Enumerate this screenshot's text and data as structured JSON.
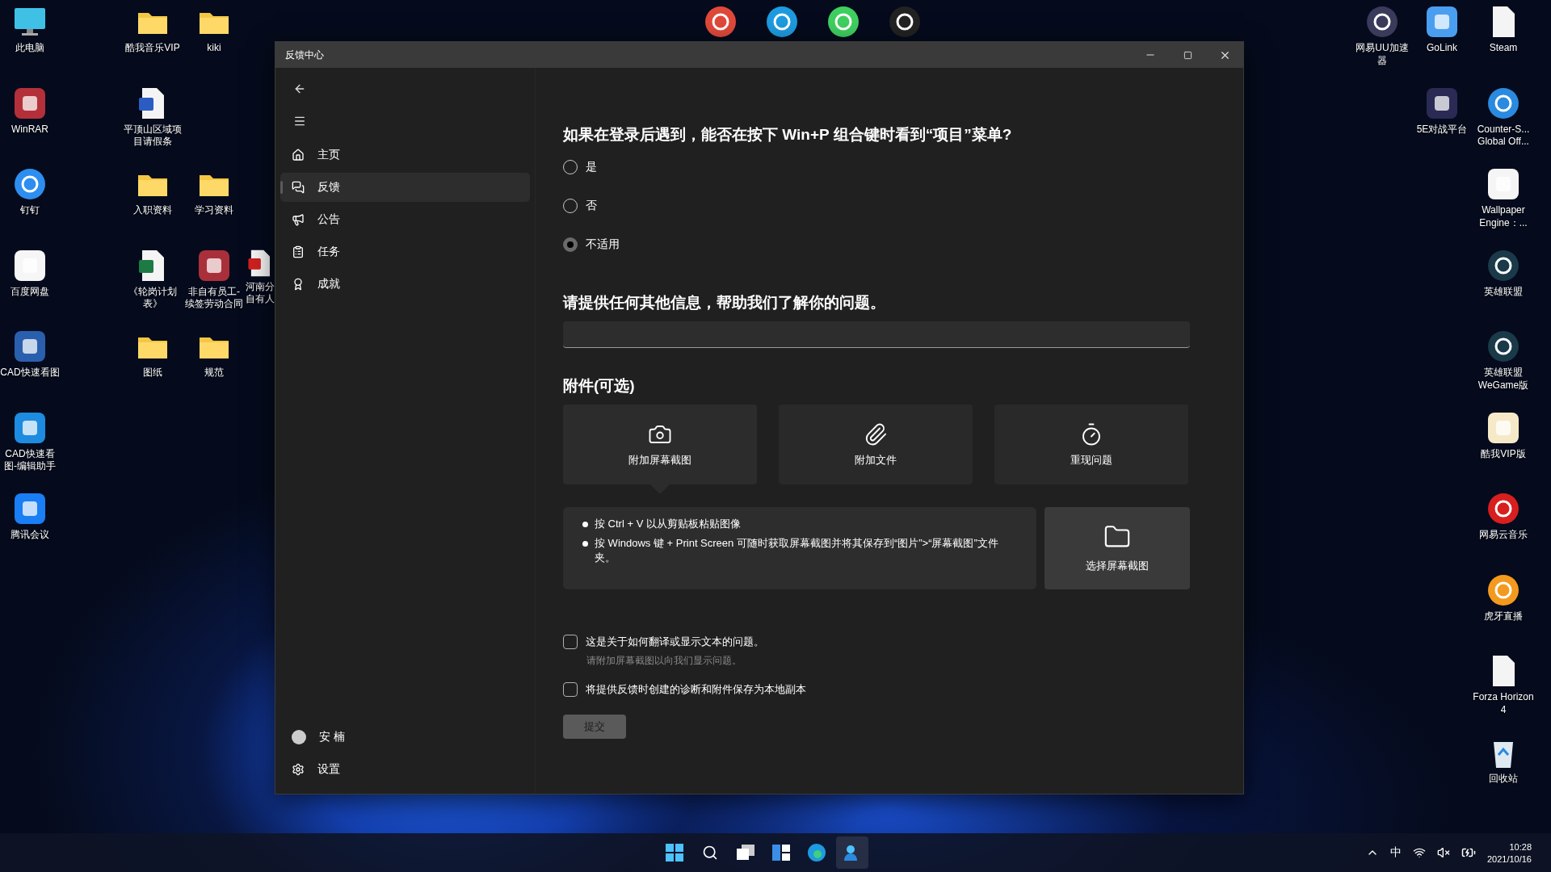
{
  "desktop": {
    "left_icons": [
      {
        "label": "此电脑"
      },
      {
        "label": "酷我音乐VIP"
      },
      {
        "label": "kiki"
      },
      {
        "label": "WinRAR"
      },
      {
        "label": "平顶山区域项目请假条"
      },
      {
        "label": "钉钉"
      },
      {
        "label": "入职资料"
      },
      {
        "label": "学习资料"
      },
      {
        "label": "百度网盘"
      },
      {
        "label": "《轮岗计划表》"
      },
      {
        "label": "非自有员工-续签劳动合同"
      },
      {
        "label": "河南分自有人"
      },
      {
        "label": "CAD快速看图"
      },
      {
        "label": "图纸"
      },
      {
        "label": "规范"
      },
      {
        "label": "CAD快速看图-编辑助手"
      },
      {
        "label": "腾讯会议"
      }
    ],
    "right_icons": [
      {
        "label": "网易UU加速器"
      },
      {
        "label": "GoLink"
      },
      {
        "label": "Steam"
      },
      {
        "label": "5E对战平台"
      },
      {
        "label": "Counter-S... Global Off..."
      },
      {
        "label": "Wallpaper Engine：..."
      },
      {
        "label": "英雄联盟"
      },
      {
        "label": "英雄联盟WeGame版"
      },
      {
        "label": "酷我VIP版"
      },
      {
        "label": "网易云音乐"
      },
      {
        "label": "虎牙直播"
      },
      {
        "label": "Forza Horizon 4"
      },
      {
        "label": "回收站"
      }
    ]
  },
  "window": {
    "title": "反馈中心",
    "sidebar": {
      "items": [
        {
          "label": "主页",
          "selected": false
        },
        {
          "label": "反馈",
          "selected": true
        },
        {
          "label": "公告",
          "selected": false
        },
        {
          "label": "任务",
          "selected": false
        },
        {
          "label": "成就",
          "selected": false
        }
      ],
      "user": "安 楠",
      "settings": "设置"
    },
    "question": {
      "title": "如果在登录后遇到，能否在按下 Win+P 组合键时看到“项目”菜单?",
      "options": [
        {
          "label": "是",
          "selected": false
        },
        {
          "label": "否",
          "selected": false
        },
        {
          "label": "不适用",
          "selected": true
        }
      ]
    },
    "details": {
      "title": "请提供任何其他信息，帮助我们了解你的问题。"
    },
    "attachments": {
      "title": "附件(可选)",
      "tiles": [
        {
          "label": "附加屏幕截图",
          "selected": true
        },
        {
          "label": "附加文件",
          "selected": false
        },
        {
          "label": "重现问题",
          "selected": false
        }
      ],
      "tips": [
        "按 Ctrl + V 以从剪贴板粘贴图像",
        "按 Windows 键 + Print Screen 可随时获取屏幕截图并将其保存到“图片”>“屏幕截图”文件夹。"
      ],
      "choose": "选择屏幕截图"
    },
    "checkboxes": [
      {
        "label": "这是关于如何翻译或显示文本的问题。",
        "hint": "请附加屏幕截图以向我们显示问题。",
        "checked": false
      },
      {
        "label": "将提供反馈时创建的诊断和附件保存为本地副本",
        "checked": false
      }
    ],
    "submit": {
      "label": "提交",
      "disabled": true
    }
  },
  "taskbar": {
    "tray": {
      "ime": "中",
      "time": "10:28",
      "date": "2021/10/16"
    }
  }
}
